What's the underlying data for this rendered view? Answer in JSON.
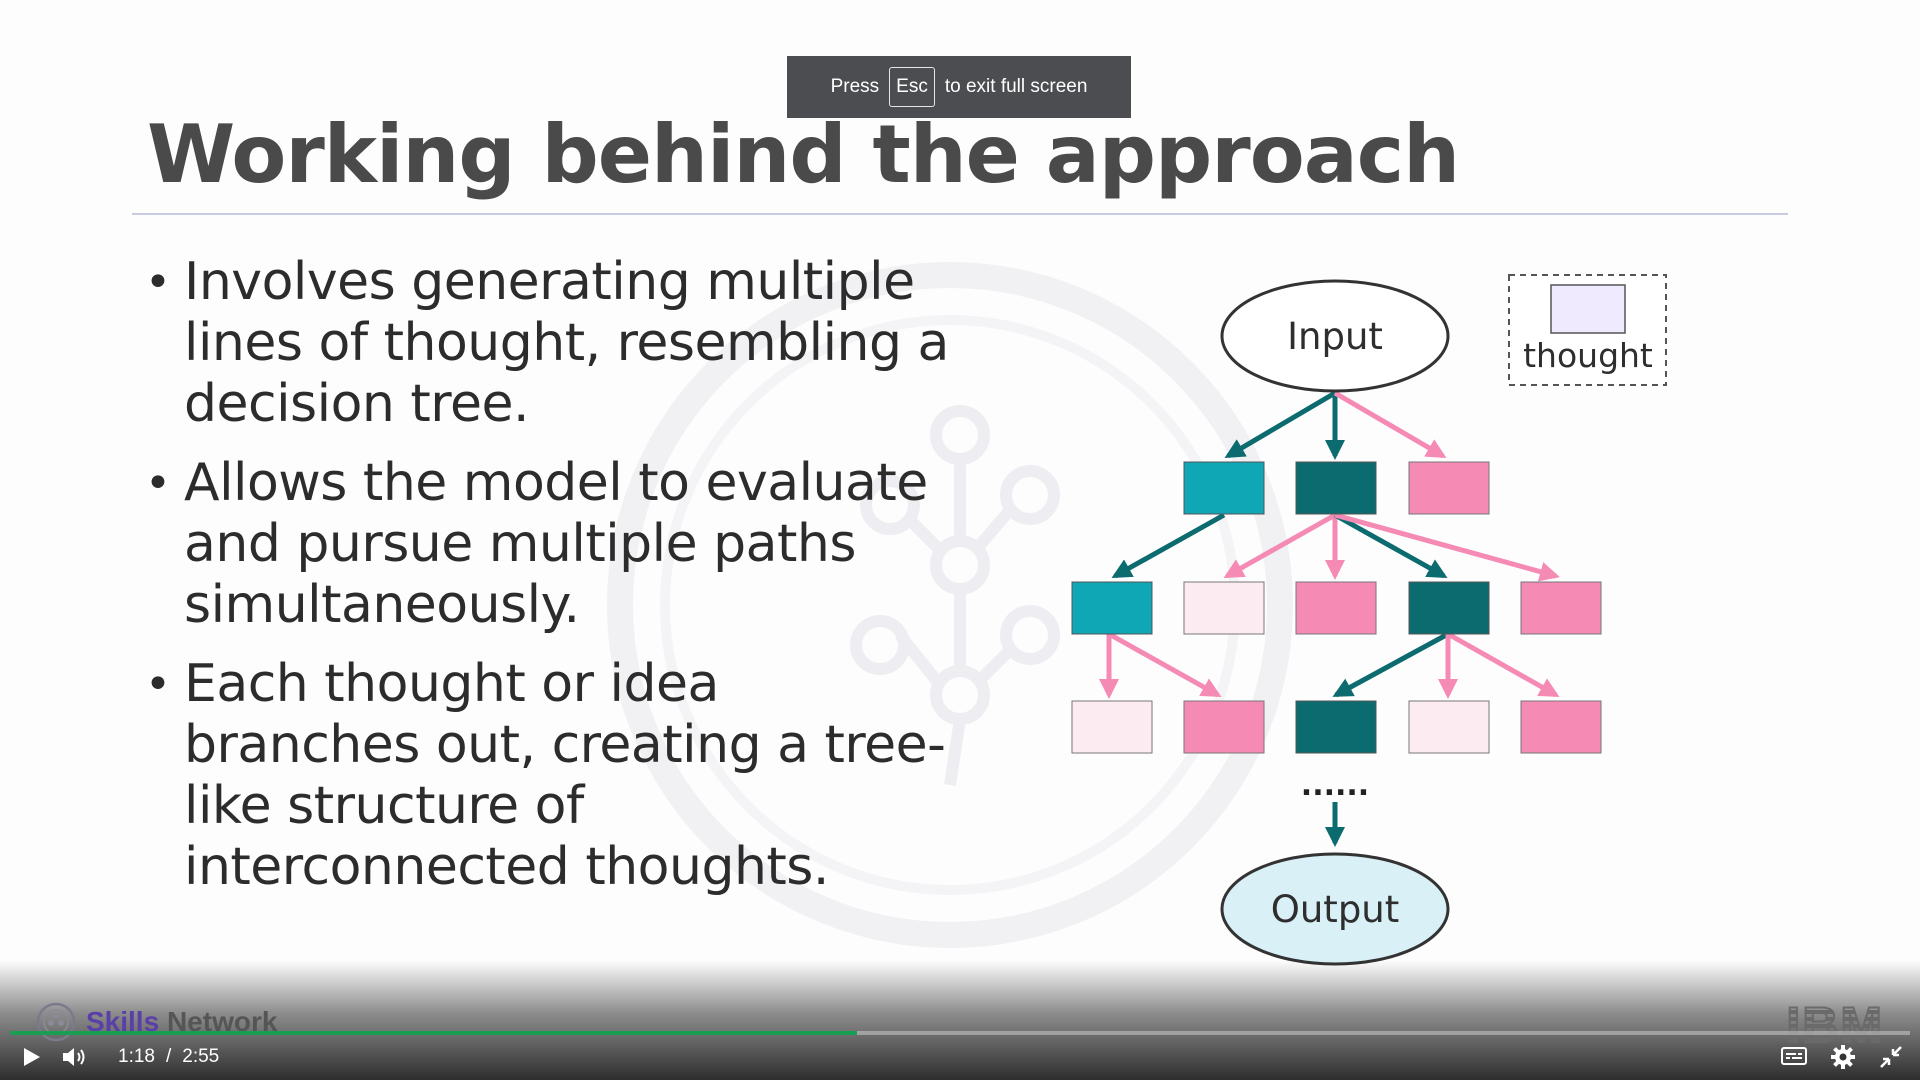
{
  "slide": {
    "title": "Working behind the approach",
    "bullets": [
      "Involves generating multiple lines of thought, resembling a decision tree.",
      "Allows the model to evaluate and pursue multiple paths simultaneously.",
      "Each thought or idea branches out, creating a tree-like structure of interconnected thoughts."
    ],
    "bullet_symbol": "•"
  },
  "diagram": {
    "input_label": "Input",
    "output_label": "Output",
    "legend_label": "thought",
    "ellipsis": "......",
    "colors": {
      "teal_light": "#0fa6b6",
      "teal_dark": "#0b6b6f",
      "pink": "#f58ab4",
      "pink_light": "#fcecf2",
      "output_fill": "#d9f0f7",
      "legend_fill": "#efeafd"
    }
  },
  "toast": {
    "prefix": "Press",
    "key": "Esc",
    "suffix": "to exit full screen"
  },
  "player": {
    "brand_skills": "Skills",
    "brand_network": "Network",
    "ibm": "IBM",
    "current_time": "1:18",
    "separator": "/",
    "duration": "2:55",
    "progress_fraction": 0.446
  },
  "icons": {
    "play": "play-icon",
    "volume": "volume-icon",
    "captions": "captions-icon",
    "settings": "gear-icon",
    "exit_fullscreen": "exit-fullscreen-icon"
  }
}
